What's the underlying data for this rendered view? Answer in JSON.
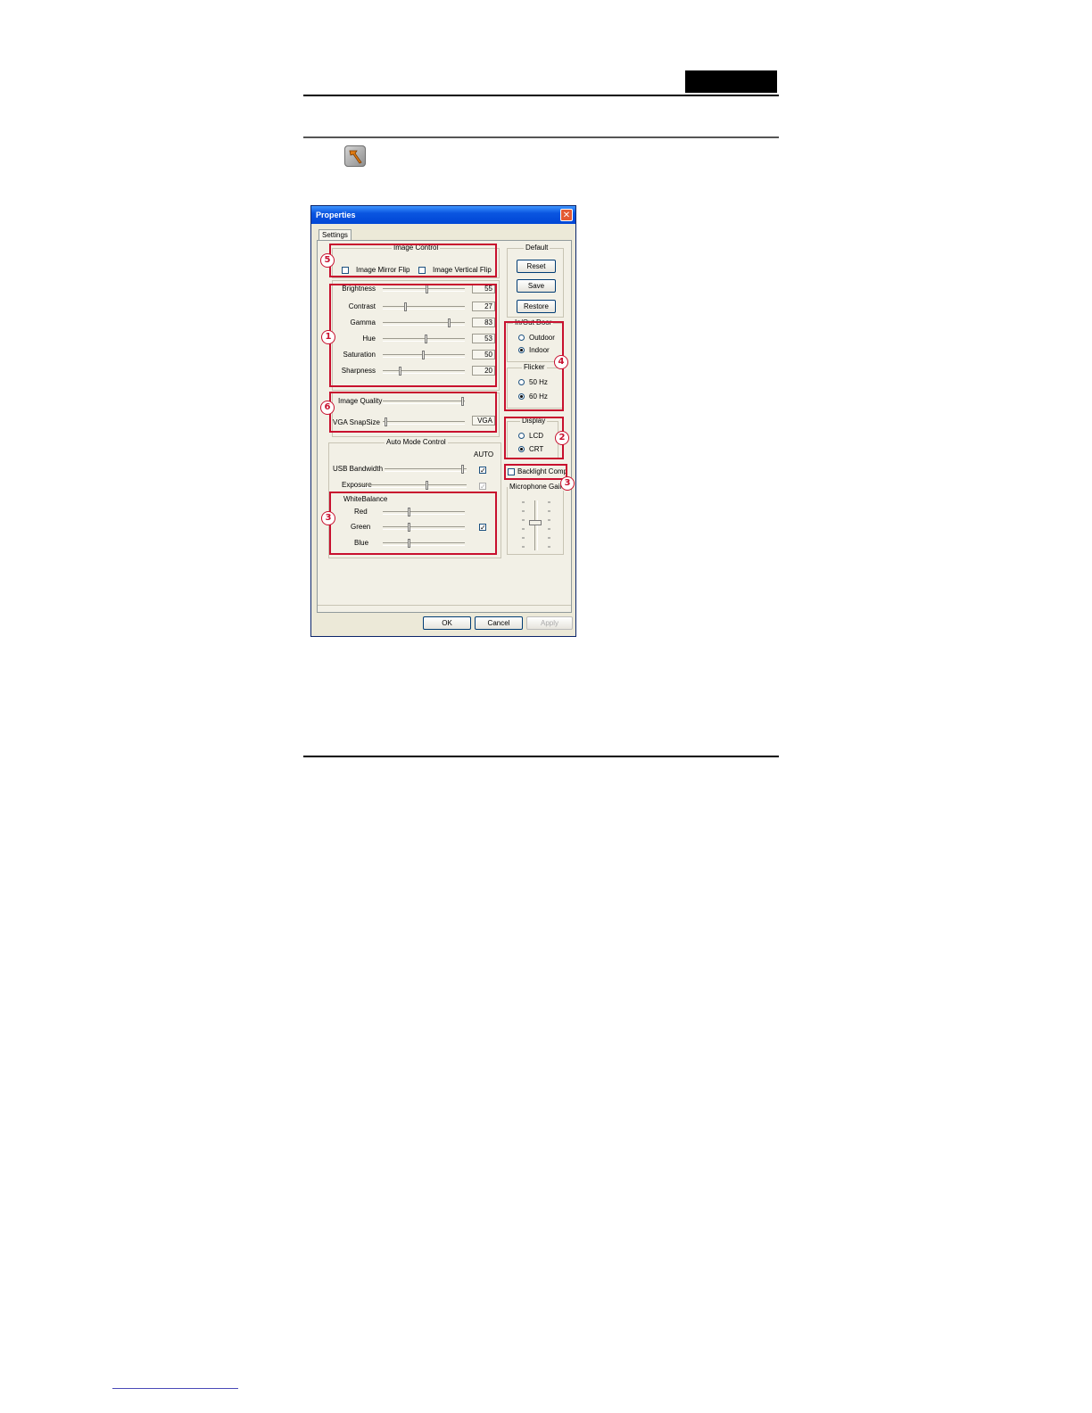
{
  "dialog": {
    "title": "Properties",
    "close_glyph": "✕",
    "tab": "Settings",
    "image_control": {
      "label": "Image Control",
      "mirror_flip": "Image Mirror Flip",
      "vertical_flip": "Image Vertical Flip"
    },
    "sliders": [
      {
        "label": "Brightness",
        "value": "55",
        "level": 0.55
      },
      {
        "label": "Contrast",
        "value": "27",
        "level": 0.27
      },
      {
        "label": "Gamma",
        "value": "83",
        "level": 0.83
      },
      {
        "label": "Hue",
        "value": "53",
        "level": 0.53
      },
      {
        "label": "Saturation",
        "value": "50",
        "level": 0.5
      },
      {
        "label": "Sharpness",
        "value": "20",
        "level": 0.2
      }
    ],
    "image_quality_label": "Image Quality",
    "vga_snap_label": "VGA SnapSize",
    "vga_snap_value": "VGA",
    "auto_mode": {
      "label": "Auto Mode Control",
      "auto_header": "AUTO",
      "usb_bandwidth": "USB Bandwidth",
      "exposure": "Exposure",
      "white_balance": "WhiteBalance",
      "red": "Red",
      "green": "Green",
      "blue": "Blue"
    },
    "default_group": {
      "label": "Default",
      "reset": "Reset",
      "save": "Save",
      "restore": "Restore"
    },
    "in_out_door": {
      "label": "In/Out Door",
      "outdoor": "Outdoor",
      "indoor": "Indoor"
    },
    "flicker": {
      "label": "Flicker",
      "hz50": "50 Hz",
      "hz60": "60 Hz"
    },
    "display": {
      "label": "Display",
      "lcd": "LCD",
      "crt": "CRT"
    },
    "backlight_comp": "Backlight Comp",
    "microphone_gain": "Microphone Gain",
    "ok": "OK",
    "cancel": "Cancel",
    "apply": "Apply"
  },
  "callouts": {
    "c1": "1",
    "c2": "2",
    "c3a": "3",
    "c3b": "3",
    "c4": "4",
    "c5": "5",
    "c6": "6"
  },
  "colors": {
    "callout_red": "#c8102e",
    "titlebar_blue": "#0a55e0",
    "dialog_bg": "#ece9d8"
  }
}
